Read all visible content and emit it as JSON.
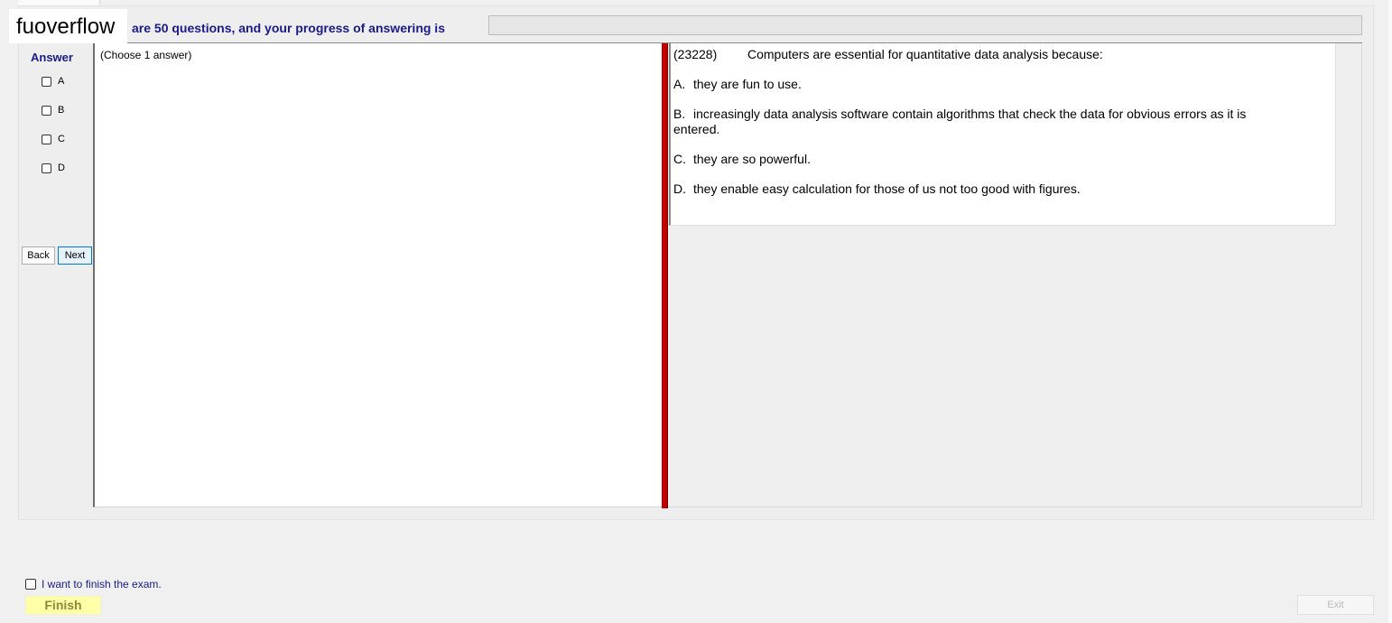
{
  "watermark": "fuoverflow",
  "header": {
    "text": "are 50 questions, and your progress of answering is",
    "progress_percent": 0
  },
  "answer_panel": {
    "title": "Answer",
    "options": [
      "A",
      "B",
      "C",
      "D"
    ],
    "back_label": "Back",
    "next_label": "Next"
  },
  "middle_panel": {
    "instruction": "(Choose 1 answer)"
  },
  "question": {
    "id": "(23228)",
    "stem": "Computers are essential for quantitative data analysis because:",
    "choices": [
      {
        "letter": "A.",
        "text": "they are fun to use."
      },
      {
        "letter": "B.",
        "text": "increasingly data analysis software contain algorithms that check the data for obvious errors as it is",
        "text_cont": "entered."
      },
      {
        "letter": "C.",
        "text": "they are so powerful."
      },
      {
        "letter": "D.",
        "text": "they enable easy calculation for those of us not too good with figures."
      }
    ]
  },
  "footer": {
    "finish_check_label": "I want to finish the exam.",
    "finish_label": "Finish",
    "exit_label": "Exit"
  },
  "colors": {
    "accent_text": "#1a1a8c",
    "splitter": "#c00000",
    "finish_bg": "#ffffa8",
    "progress_fill": "#06b025"
  }
}
